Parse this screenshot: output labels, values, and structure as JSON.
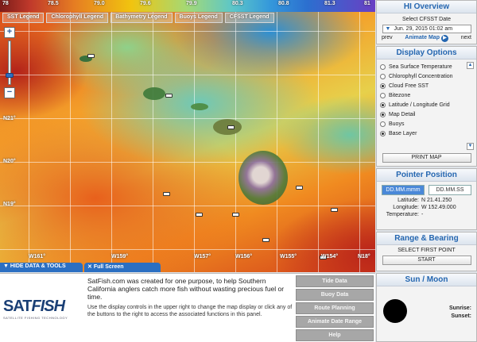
{
  "sst_scale": {
    "ticks": [
      "78",
      "78.5",
      "79.0",
      "79.6",
      "79.9",
      "80.3",
      "80.8",
      "81.3",
      "81"
    ]
  },
  "legends": [
    "SST Legend",
    "Chlorophyll Legend",
    "Bathymetry Legend",
    "Buoys Legend",
    "CFSST Legend"
  ],
  "map": {
    "lat_labels": [
      "N21°",
      "N20°",
      "N19°"
    ],
    "lon_labels": [
      "W161°",
      "W159°",
      "W157°",
      "W156°",
      "W155°",
      "W154°",
      "N18°"
    ],
    "hide_tab": "HIDE DATA & TOOLS",
    "full_tab": "Full Screen",
    "zoom_in": "+",
    "zoom_out": "−"
  },
  "overview": {
    "title": "HI Overview",
    "select_label": "Select CFSST Date",
    "date_value": "Jun. 29, 2015 01:02 am",
    "prev": "prev",
    "animate": "Animate Map",
    "next": "next"
  },
  "options": {
    "title": "Display Options",
    "items": [
      {
        "label": "Sea Surface Temperature",
        "checked": false
      },
      {
        "label": "Chlorophyll Concentration",
        "checked": false
      },
      {
        "label": "Cloud Free SST",
        "checked": true
      },
      {
        "label": "Bitezone",
        "checked": false
      },
      {
        "label": "Latitude / Longitude Grid",
        "checked": true
      },
      {
        "label": "Map Detail",
        "checked": true
      },
      {
        "label": "Buoys",
        "checked": false
      },
      {
        "label": "Base Layer",
        "checked": true
      }
    ],
    "print": "PRINT MAP"
  },
  "pointer": {
    "title": "Pointer Position",
    "fmt_a": "DD.MM.mmm",
    "fmt_b": "DD.MM.SS",
    "lat_label": "Latitude:",
    "lat_value": "N 21.41.250",
    "lon_label": "Longitude:",
    "lon_value": "W 152.49.000",
    "temp_label": "Temperature:",
    "temp_value": "-"
  },
  "range": {
    "title": "Range & Bearing",
    "sub": "SELECT FIRST POINT",
    "start": "START"
  },
  "bottom": {
    "logo_a": "SAT",
    "logo_b": "FISH",
    "logo_tag": "SATELLITE FISHING TECHNOLOGY",
    "desc1": "SatFish.com was created for one purpose, to help Southern California anglers catch more fish without wasting precious fuel or time.",
    "desc2": "Use the display controls in the upper right to change the map display or click any of the buttons to the right to access the associated functions in this panel.",
    "tools": [
      "Tide Data",
      "Buoy Data",
      "Route Planning",
      "Animate Date Range",
      "Help"
    ]
  },
  "sun": {
    "title": "Sun / Moon",
    "sunrise": "Sunrise:",
    "sunset": "Sunset:"
  }
}
